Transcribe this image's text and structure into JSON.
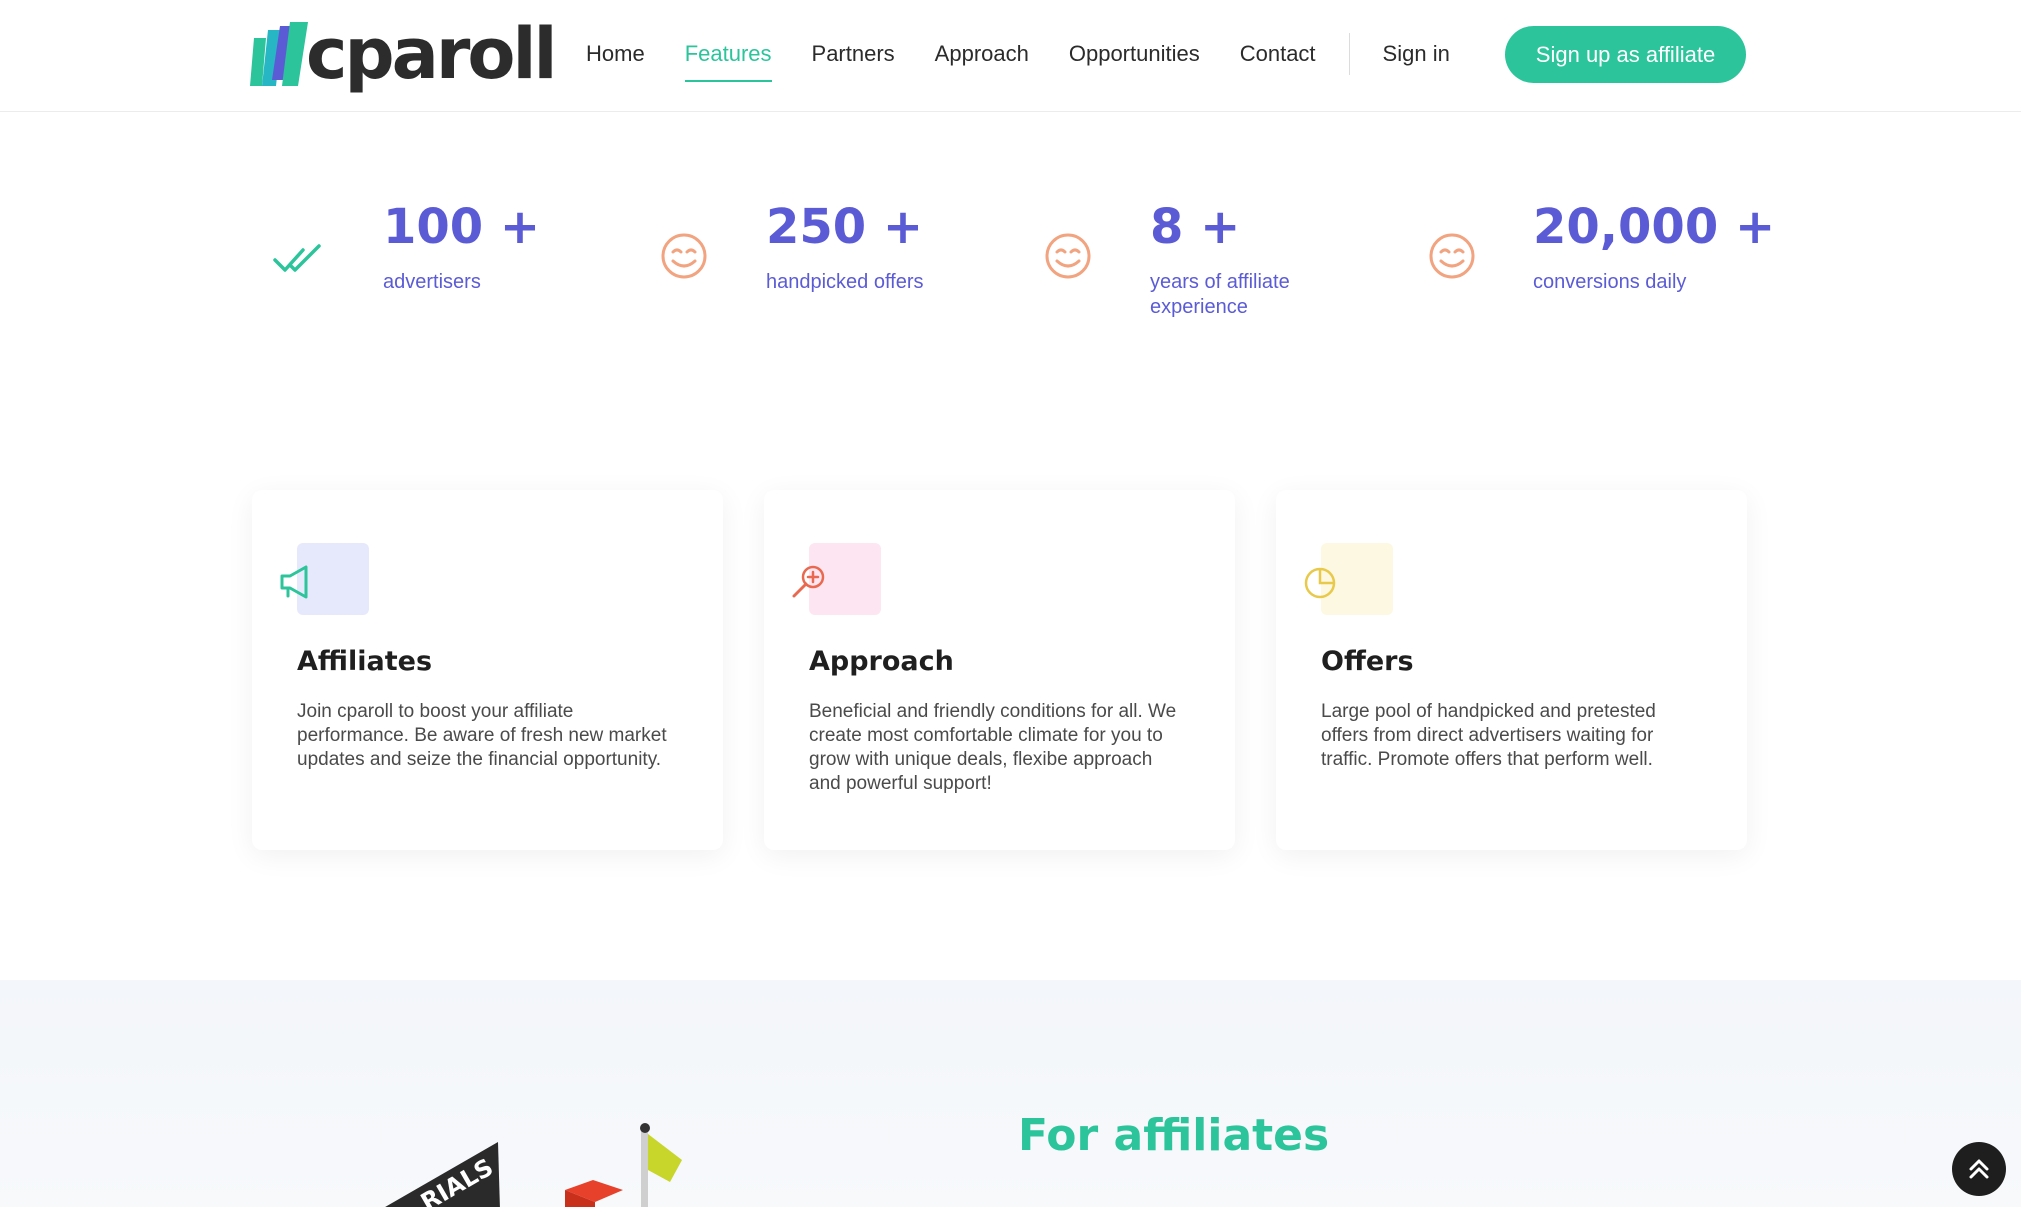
{
  "brand": {
    "name": "cparoll",
    "accent": "#2cc49a",
    "stat_color": "#5b5bd6"
  },
  "nav": {
    "items": [
      {
        "label": "Home",
        "active": false
      },
      {
        "label": "Features",
        "active": true
      },
      {
        "label": "Partners",
        "active": false
      },
      {
        "label": "Approach",
        "active": false
      },
      {
        "label": "Opportunities",
        "active": false
      },
      {
        "label": "Contact",
        "active": false
      }
    ],
    "sign_in": "Sign in",
    "signup": "Sign up as affiliate"
  },
  "stats": [
    {
      "value": "100 +",
      "label": "advertisers",
      "icon": "double-check-icon"
    },
    {
      "value": "250 +",
      "label": "handpicked offers",
      "icon": "smiley-icon"
    },
    {
      "value": "8 +",
      "label": "years of affiliate experience",
      "icon": "smiley-icon"
    },
    {
      "value": "20,000 +",
      "label": "conversions daily",
      "icon": "smiley-icon"
    }
  ],
  "cards": [
    {
      "title": "Affiliates",
      "text": "Join cparoll to boost your affiliate performance. Be aware of fresh new market updates and seize the financial opportunity.",
      "icon": "megaphone-icon"
    },
    {
      "title": "Approach",
      "text": "Beneficial and friendly conditions for all. We create most comfortable climate for you to grow with unique deals, flexibe approach and powerful support!",
      "icon": "magnifier-plus-icon"
    },
    {
      "title": "Offers",
      "text": "Large pool of handpicked and pretested offers from direct advertisers waiting for traffic. Promote offers that perform well.",
      "icon": "pie-chart-icon"
    }
  ],
  "section": {
    "title": "For affiliates",
    "illustration_sign": "RIALS"
  }
}
